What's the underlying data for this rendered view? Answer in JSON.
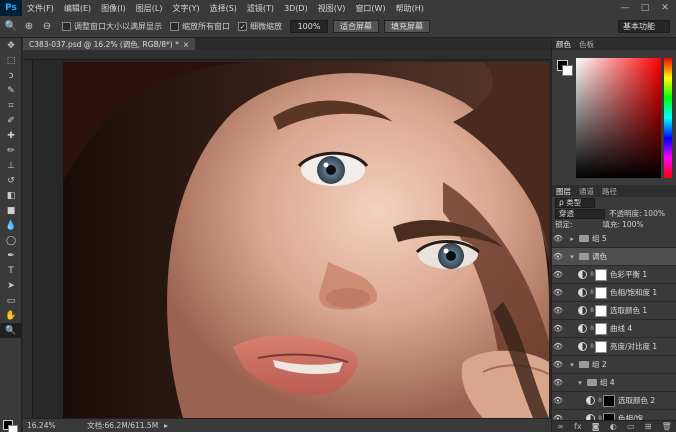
{
  "menu": {
    "logo": "Ps",
    "items": [
      "文件(F)",
      "编辑(E)",
      "图像(I)",
      "图层(L)",
      "文字(Y)",
      "选择(S)",
      "滤镜(T)",
      "3D(D)",
      "视图(V)",
      "窗口(W)",
      "帮助(H)"
    ],
    "minimize": "—",
    "maximize": "□",
    "close": "✕"
  },
  "options": {
    "resize_windows": "调整窗口大小以满屏显示",
    "zoom_all": "缩放所有窗口",
    "scrubby_zoom": "细微缩放",
    "zoom_value": "100%",
    "fit_screen": "适合屏幕",
    "fill_screen": "填充屏幕",
    "workspace": "基本功能"
  },
  "document": {
    "tab_title": "C383-037.psd @ 16.2% (调色, RGB/8*) *",
    "tab_close": "×"
  },
  "status": {
    "zoom": "16.24%",
    "doc_info": "文档:66.2M/611.5M",
    "arrow": "▸"
  },
  "color_panel": {
    "tabs": [
      "颜色",
      "色板"
    ]
  },
  "layers_panel": {
    "tabs": [
      "图层",
      "通道",
      "路径"
    ],
    "filter": "ρ 类型",
    "blend_mode": "穿透",
    "opacity_label": "不透明度:",
    "opacity_value": "100%",
    "lock_label": "锁定:",
    "fill_label": "填充:",
    "fill_value": "100%",
    "layers": [
      {
        "name": "组 5",
        "type": "group",
        "indent": 0
      },
      {
        "name": "调色",
        "type": "group-open",
        "indent": 0
      },
      {
        "name": "色彩平衡 1",
        "type": "adj",
        "indent": 1,
        "mask": "white"
      },
      {
        "name": "色相/饱和度 1",
        "type": "adj",
        "indent": 1,
        "mask": "white"
      },
      {
        "name": "选取颜色 1",
        "type": "adj",
        "indent": 1,
        "mask": "white"
      },
      {
        "name": "曲线 4",
        "type": "adj",
        "indent": 1,
        "mask": "white"
      },
      {
        "name": "亮度/对比度 1",
        "type": "adj",
        "indent": 1,
        "mask": "white"
      },
      {
        "name": "组 2",
        "type": "group-open",
        "indent": 0
      },
      {
        "name": "组 4",
        "type": "group-open",
        "indent": 1
      },
      {
        "name": "选取颜色 2",
        "type": "adj",
        "indent": 2,
        "mask": "black"
      },
      {
        "name": "色相/饱...",
        "type": "adj",
        "indent": 2,
        "mask": "black"
      }
    ],
    "bottom_icons": [
      "∞",
      "fx",
      "◙",
      "◐",
      "▭",
      "⊞",
      "🗑"
    ]
  },
  "tools": [
    "move-icon",
    "marquee-icon",
    "lasso-icon",
    "quick-select-icon",
    "crop-icon",
    "eyedropper-icon",
    "healing-icon",
    "brush-icon",
    "stamp-icon",
    "history-brush-icon",
    "eraser-icon",
    "gradient-icon",
    "blur-icon",
    "dodge-icon",
    "pen-icon",
    "type-icon",
    "path-select-icon",
    "shape-icon",
    "hand-icon",
    "zoom-icon"
  ],
  "tool_glyphs": [
    "✥",
    "⬚",
    "ↄ",
    "✎",
    "⌗",
    "✐",
    "✚",
    "✏",
    "⊥",
    "↺",
    "◧",
    "■",
    "💧",
    "◯",
    "✒",
    "T",
    "➤",
    "▭",
    "✋",
    "🔍"
  ]
}
